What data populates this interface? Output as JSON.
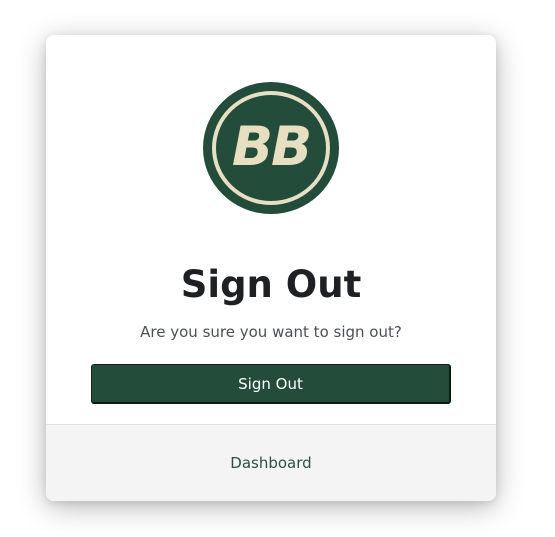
{
  "logo": {
    "text": "BB",
    "bg_color": "#234d3a",
    "fg_color": "#e6dfc2"
  },
  "dialog": {
    "title": "Sign Out",
    "message": "Are you sure you want to sign out?",
    "confirm_label": "Sign Out",
    "accent_color": "#234d3a"
  },
  "footer": {
    "link_label": "Dashboard"
  }
}
